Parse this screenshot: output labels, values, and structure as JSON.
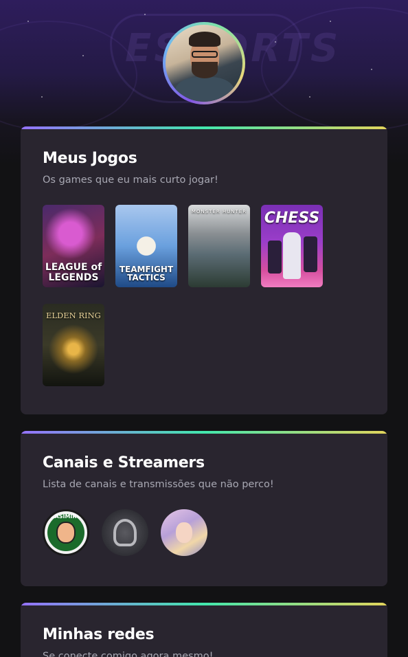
{
  "profile": {
    "avatar_alt": "profile-photo"
  },
  "games_section": {
    "title": "Meus Jogos",
    "subtitle": "Os games que eu mais curto jogar!",
    "games": [
      {
        "label": "LEAGUE of LEGENDS",
        "icon": "league-of-legends-cover"
      },
      {
        "label": "TEAMFIGHT TACTICS",
        "icon": "teamfight-tactics-cover"
      },
      {
        "label": "MONSTER HUNTER",
        "icon": "monster-hunter-cover"
      },
      {
        "label": "CHESS",
        "icon": "chess-cover"
      },
      {
        "label": "ELDEN RING",
        "icon": "elden-ring-cover"
      }
    ]
  },
  "streamers_section": {
    "title": "Canais e Streamers",
    "subtitle": "Lista de canais e transmissões que não perco!",
    "streamers": [
      {
        "label": "CASIMIRO",
        "icon": "casimiro-avatar"
      },
      {
        "label": "",
        "icon": "riot-games-avatar"
      },
      {
        "label": "",
        "icon": "anime-girl-avatar"
      }
    ]
  },
  "networks_section": {
    "title": "Minhas redes",
    "subtitle": "Se conecte comigo agora mesmo!"
  },
  "colors": {
    "background": "#121214",
    "card": "#29252f",
    "gradient_start": "#9572fc",
    "gradient_mid": "#43e7ad",
    "gradient_end": "#e2d45c",
    "subtitle": "#a8a8b3"
  }
}
